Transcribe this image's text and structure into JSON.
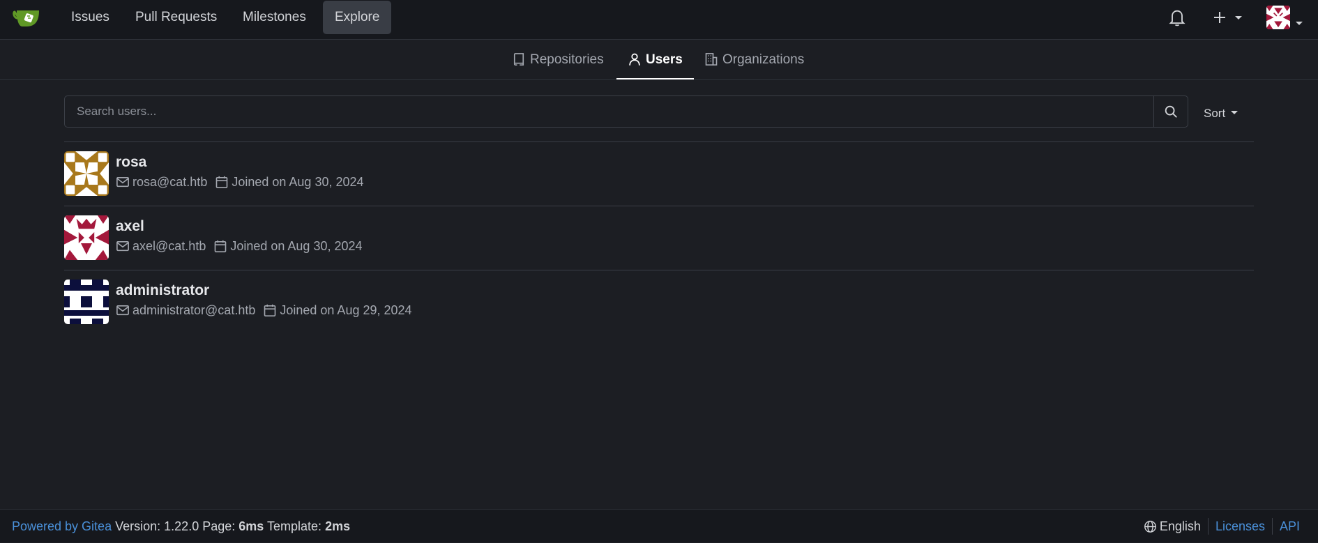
{
  "nav": {
    "items": [
      {
        "label": "Issues"
      },
      {
        "label": "Pull Requests"
      },
      {
        "label": "Milestones"
      },
      {
        "label": "Explore"
      }
    ]
  },
  "tabs": [
    {
      "label": "Repositories"
    },
    {
      "label": "Users"
    },
    {
      "label": "Organizations"
    }
  ],
  "search": {
    "placeholder": "Search users...",
    "value": ""
  },
  "sort": {
    "label": "Sort"
  },
  "users": [
    {
      "name": "rosa",
      "email": "rosa@cat.htb",
      "joined": "Joined on Aug 30, 2024"
    },
    {
      "name": "axel",
      "email": "axel@cat.htb",
      "joined": "Joined on Aug 30, 2024"
    },
    {
      "name": "administrator",
      "email": "administrator@cat.htb",
      "joined": "Joined on Aug 29, 2024"
    }
  ],
  "footer": {
    "powered_by": "Powered by Gitea",
    "version_label": "Version:",
    "version": "1.22.0",
    "page_label": "Page:",
    "page_time": "6ms",
    "template_label": "Template:",
    "template_time": "2ms",
    "language": "English",
    "licenses": "Licenses",
    "api": "API"
  },
  "colors": {
    "background": "#1c1e23",
    "navbar": "#16181d",
    "link": "#4a90d9",
    "logo_green": "#609926",
    "rosa_avatar": "#a8781b",
    "axel_avatar": "#a3183b",
    "admin_avatar": "#0c0f3c"
  },
  "icons": [
    "gitea-logo-icon",
    "bell-icon",
    "plus-icon",
    "repo-icon",
    "person-icon",
    "organization-icon",
    "search-icon",
    "mail-icon",
    "calendar-icon",
    "globe-icon"
  ]
}
